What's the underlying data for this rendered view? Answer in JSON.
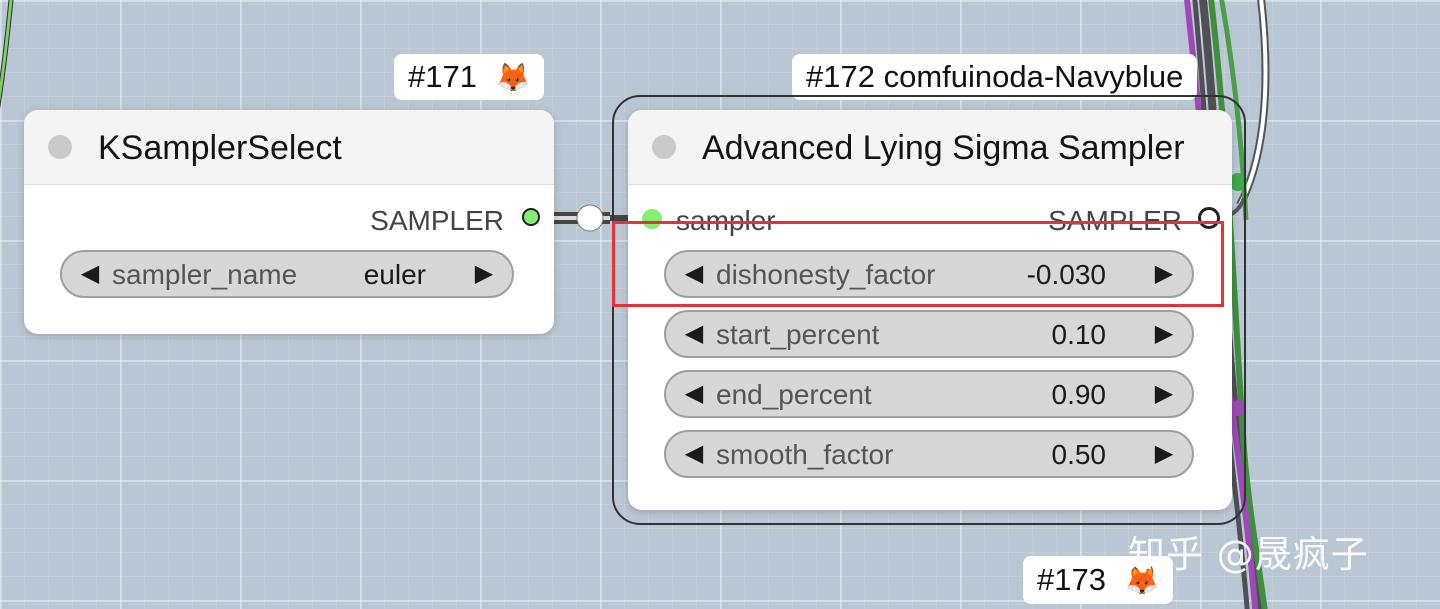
{
  "badges": {
    "n171": {
      "text": "#171",
      "emoji": "🦊"
    },
    "n172": {
      "text": "#172 comfuinoda-Navyblue"
    },
    "n173": {
      "text": "#173",
      "emoji": "🦊"
    }
  },
  "nodes": {
    "ksampler_select": {
      "title": "KSamplerSelect",
      "output_label": "SAMPLER",
      "widget": {
        "label": "sampler_name",
        "value": "euler"
      }
    },
    "advanced_lying": {
      "title": "Advanced Lying Sigma Sampler",
      "input_label": "sampler",
      "output_label": "SAMPLER",
      "widgets": [
        {
          "label": "dishonesty_factor",
          "value": "-0.030"
        },
        {
          "label": "start_percent",
          "value": "0.10"
        },
        {
          "label": "end_percent",
          "value": "0.90"
        },
        {
          "label": "smooth_factor",
          "value": "0.50"
        }
      ]
    }
  },
  "watermark": "知乎 @晟疯子",
  "colors": {
    "canvas": "#b9c6d3",
    "highlight": "#e0343a",
    "port_green": "#86ef73",
    "wire_green": "#4c9f4a",
    "wire_purple": "#9d49b8",
    "wire_dark": "#4f4f56"
  },
  "icons": {
    "arrow_left": "◀",
    "arrow_right": "▶"
  }
}
